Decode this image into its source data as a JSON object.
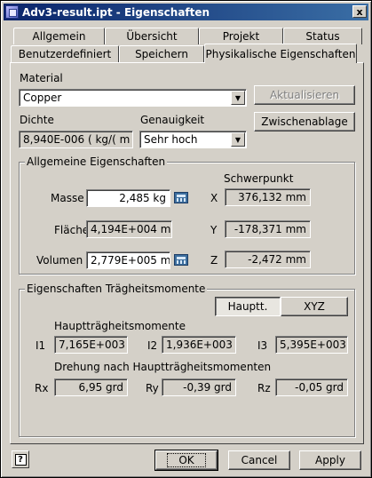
{
  "window": {
    "title": "Adv3-result.ipt - Eigenschaften",
    "close": "x"
  },
  "tabs": {
    "row1": [
      "Allgemein",
      "Übersicht",
      "Projekt",
      "Status"
    ],
    "row2": [
      "Benutzerdefiniert",
      "Speichern",
      "Physikalische Eigenschaften"
    ],
    "active": "Physikalische Eigenschaften"
  },
  "material": {
    "label": "Material",
    "value": "Copper",
    "update_button": "Aktualisieren",
    "clipboard_button": "Zwischenablage"
  },
  "density": {
    "label": "Dichte",
    "value": "8,940E-006 ( kg/( m"
  },
  "accuracy": {
    "label": "Genauigkeit",
    "value": "Sehr hoch"
  },
  "general": {
    "title": "Allgemeine Eigenschaften",
    "centroid_title": "Schwerpunkt",
    "mass": {
      "label": "Masse",
      "value": "2,485 kg"
    },
    "area": {
      "label": "Fläche",
      "value": "4,194E+004 mr"
    },
    "volume": {
      "label": "Volumen",
      "value": "2,779E+005 mr"
    },
    "x": {
      "label": "X",
      "value": "376,132 mm"
    },
    "y": {
      "label": "Y",
      "value": "-178,371 mm"
    },
    "z": {
      "label": "Z",
      "value": "-2,472 mm"
    }
  },
  "inertia": {
    "title": "Eigenschaften Trägheitsmomente",
    "mode_principal": "Hauptt.",
    "mode_xyz": "XYZ",
    "principal_title": "Hauptträgheitsmomente",
    "i1": {
      "label": "I1",
      "value": "7,165E+003"
    },
    "i2": {
      "label": "I2",
      "value": "1,936E+003"
    },
    "i3": {
      "label": "I3",
      "value": "5,395E+003"
    },
    "rotation_title": "Drehung nach Hauptträgheitsmomenten",
    "rx": {
      "label": "Rx",
      "value": "6,95 grd"
    },
    "ry": {
      "label": "Ry",
      "value": "-0,39 grd"
    },
    "rz": {
      "label": "Rz",
      "value": "-0,05 grd"
    }
  },
  "footer": {
    "help": "?",
    "ok": "OK",
    "cancel": "Cancel",
    "apply": "Apply"
  }
}
